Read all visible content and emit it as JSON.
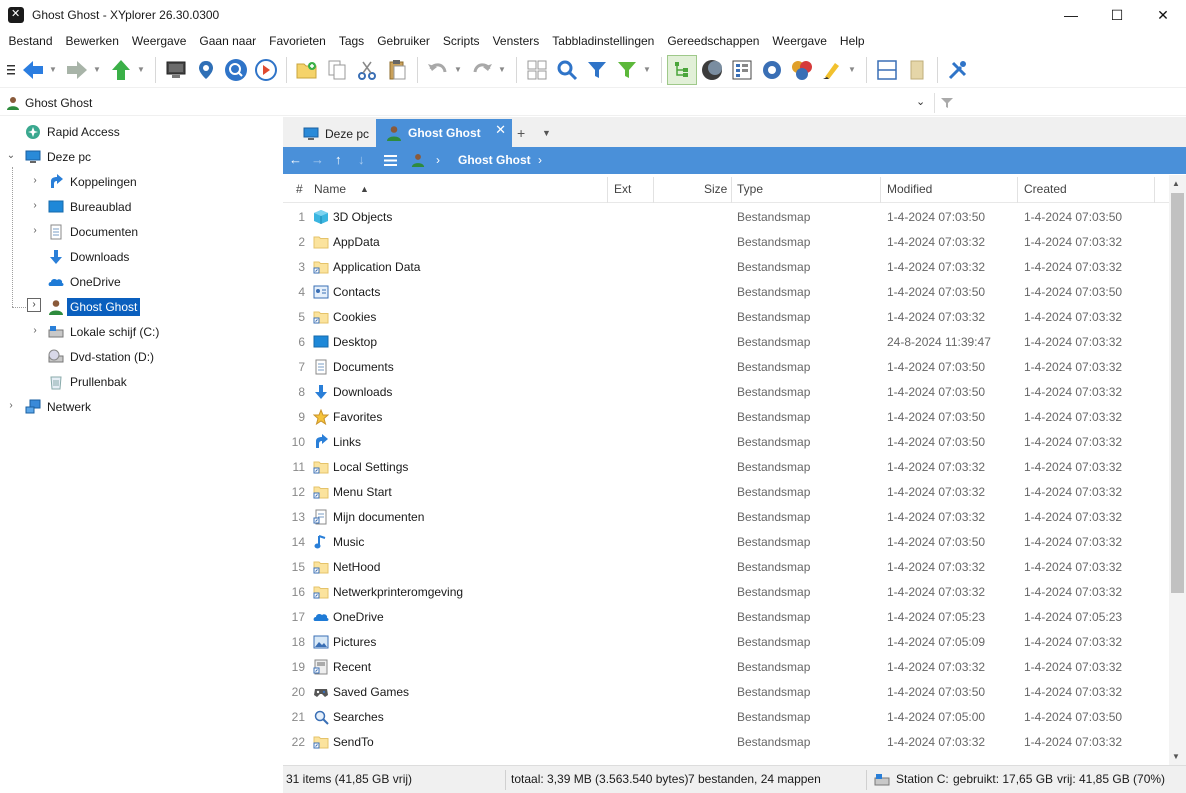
{
  "window": {
    "title": "Ghost Ghost - XYplorer 26.30.0300",
    "minimize": "—",
    "maximize": "☐",
    "close": "✕"
  },
  "menu": [
    "Bestand",
    "Bewerken",
    "Weergave",
    "Gaan naar",
    "Favorieten",
    "Tags",
    "Gebruiker",
    "Scripts",
    "Vensters",
    "Tabbladinstellingen",
    "Gereedschappen",
    "Weergave",
    "Help"
  ],
  "address": {
    "path": "Ghost Ghost"
  },
  "tree": {
    "items": [
      {
        "label": "Rapid Access",
        "icon": "rapid-access-icon"
      },
      {
        "label": "Deze pc",
        "icon": "computer-icon"
      },
      {
        "label": "Koppelingen",
        "icon": "links-icon"
      },
      {
        "label": "Bureaublad",
        "icon": "desktop-icon"
      },
      {
        "label": "Documenten",
        "icon": "documents-icon"
      },
      {
        "label": "Downloads",
        "icon": "downloads-icon"
      },
      {
        "label": "OneDrive",
        "icon": "onedrive-icon"
      },
      {
        "label": "Ghost Ghost",
        "icon": "user-icon"
      },
      {
        "label": "Lokale schijf (C:)",
        "icon": "drive-icon"
      },
      {
        "label": "Dvd-station (D:)",
        "icon": "dvd-icon"
      },
      {
        "label": "Prullenbak",
        "icon": "recycle-bin-icon"
      },
      {
        "label": "Netwerk",
        "icon": "network-icon"
      }
    ]
  },
  "tabs": [
    {
      "label": "Deze pc"
    },
    {
      "label": "Ghost Ghost"
    }
  ],
  "breadcrumb": {
    "current": "Ghost Ghost"
  },
  "columns": {
    "num": "#",
    "name": "Name",
    "ext": "Ext",
    "size": "Size",
    "type": "Type",
    "modified": "Modified",
    "created": "Created"
  },
  "files": [
    {
      "n": "1",
      "name": "3D Objects",
      "type": "Bestandsmap",
      "mod": "1-4-2024 07:03:50",
      "cre": "1-4-2024 07:03:50",
      "icon": "3d-objects-icon"
    },
    {
      "n": "2",
      "name": "AppData",
      "type": "Bestandsmap",
      "mod": "1-4-2024 07:03:32",
      "cre": "1-4-2024 07:03:32",
      "icon": "folder-icon"
    },
    {
      "n": "3",
      "name": "Application Data",
      "type": "Bestandsmap",
      "mod": "1-4-2024 07:03:32",
      "cre": "1-4-2024 07:03:32",
      "icon": "junction-folder-icon"
    },
    {
      "n": "4",
      "name": "Contacts",
      "type": "Bestandsmap",
      "mod": "1-4-2024 07:03:50",
      "cre": "1-4-2024 07:03:50",
      "icon": "contacts-icon"
    },
    {
      "n": "5",
      "name": "Cookies",
      "type": "Bestandsmap",
      "mod": "1-4-2024 07:03:32",
      "cre": "1-4-2024 07:03:32",
      "icon": "junction-folder-icon"
    },
    {
      "n": "6",
      "name": "Desktop",
      "type": "Bestandsmap",
      "mod": "24-8-2024 11:39:47",
      "cre": "1-4-2024 07:03:32",
      "icon": "desktop-icon"
    },
    {
      "n": "7",
      "name": "Documents",
      "type": "Bestandsmap",
      "mod": "1-4-2024 07:03:50",
      "cre": "1-4-2024 07:03:32",
      "icon": "documents-icon"
    },
    {
      "n": "8",
      "name": "Downloads",
      "type": "Bestandsmap",
      "mod": "1-4-2024 07:03:50",
      "cre": "1-4-2024 07:03:32",
      "icon": "downloads-icon"
    },
    {
      "n": "9",
      "name": "Favorites",
      "type": "Bestandsmap",
      "mod": "1-4-2024 07:03:50",
      "cre": "1-4-2024 07:03:32",
      "icon": "star-icon"
    },
    {
      "n": "10",
      "name": "Links",
      "type": "Bestandsmap",
      "mod": "1-4-2024 07:03:50",
      "cre": "1-4-2024 07:03:32",
      "icon": "links-icon"
    },
    {
      "n": "11",
      "name": "Local Settings",
      "type": "Bestandsmap",
      "mod": "1-4-2024 07:03:32",
      "cre": "1-4-2024 07:03:32",
      "icon": "junction-folder-icon"
    },
    {
      "n": "12",
      "name": "Menu Start",
      "type": "Bestandsmap",
      "mod": "1-4-2024 07:03:32",
      "cre": "1-4-2024 07:03:32",
      "icon": "junction-folder-icon"
    },
    {
      "n": "13",
      "name": "Mijn documenten",
      "type": "Bestandsmap",
      "mod": "1-4-2024 07:03:32",
      "cre": "1-4-2024 07:03:32",
      "icon": "junction-documents-icon"
    },
    {
      "n": "14",
      "name": "Music",
      "type": "Bestandsmap",
      "mod": "1-4-2024 07:03:50",
      "cre": "1-4-2024 07:03:32",
      "icon": "music-icon"
    },
    {
      "n": "15",
      "name": "NetHood",
      "type": "Bestandsmap",
      "mod": "1-4-2024 07:03:32",
      "cre": "1-4-2024 07:03:32",
      "icon": "junction-folder-icon"
    },
    {
      "n": "16",
      "name": "Netwerkprinteromgeving",
      "type": "Bestandsmap",
      "mod": "1-4-2024 07:03:32",
      "cre": "1-4-2024 07:03:32",
      "icon": "junction-folder-icon"
    },
    {
      "n": "17",
      "name": "OneDrive",
      "type": "Bestandsmap",
      "mod": "1-4-2024 07:05:23",
      "cre": "1-4-2024 07:05:23",
      "icon": "onedrive-icon"
    },
    {
      "n": "18",
      "name": "Pictures",
      "type": "Bestandsmap",
      "mod": "1-4-2024 07:05:09",
      "cre": "1-4-2024 07:03:32",
      "icon": "pictures-icon"
    },
    {
      "n": "19",
      "name": "Recent",
      "type": "Bestandsmap",
      "mod": "1-4-2024 07:03:32",
      "cre": "1-4-2024 07:03:32",
      "icon": "junction-recent-icon"
    },
    {
      "n": "20",
      "name": "Saved Games",
      "type": "Bestandsmap",
      "mod": "1-4-2024 07:03:50",
      "cre": "1-4-2024 07:03:32",
      "icon": "saved-games-icon"
    },
    {
      "n": "21",
      "name": "Searches",
      "type": "Bestandsmap",
      "mod": "1-4-2024 07:05:00",
      "cre": "1-4-2024 07:03:50",
      "icon": "search-icon"
    },
    {
      "n": "22",
      "name": "SendTo",
      "type": "Bestandsmap",
      "mod": "1-4-2024 07:03:32",
      "cre": "1-4-2024 07:03:32",
      "icon": "junction-folder-icon"
    }
  ],
  "status": {
    "items": "31 items (41,85 GB vrij)",
    "total": "totaal: 3,39 MB (3.563.540 bytes)",
    "counts": "7 bestanden, 24 mappen",
    "drive": "Station C:",
    "used": "gebruikt: 17,65 GB",
    "free": "vrij: 41,85 GB (70%)"
  },
  "colors": {
    "accent": "#4a90d9",
    "selection": "#0a5fbe",
    "folder": "#fbe39d"
  }
}
